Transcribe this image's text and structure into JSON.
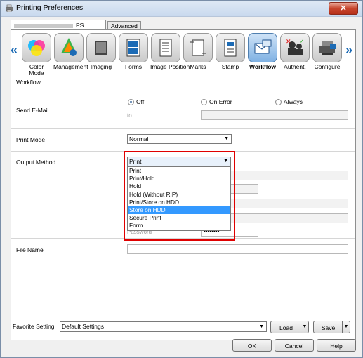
{
  "window": {
    "title": "Printing Preferences",
    "close_glyph": "✕"
  },
  "tabs": [
    {
      "label": "PS"
    },
    {
      "label": "Advanced"
    }
  ],
  "ribbon": {
    "left_arrow": "«",
    "right_arrow": "»",
    "tools": [
      {
        "label": "Color\nMode",
        "icon": "color-mode-icon"
      },
      {
        "label": "Management",
        "icon": "management-icon"
      },
      {
        "label": "Imaging",
        "icon": "imaging-icon"
      },
      {
        "label": "Forms",
        "icon": "forms-icon"
      },
      {
        "label": "Image Position",
        "icon": "image-position-icon"
      },
      {
        "label": "Marks",
        "icon": "marks-icon"
      },
      {
        "label": "Stamp",
        "icon": "stamp-icon"
      },
      {
        "label": "Workflow",
        "icon": "workflow-icon",
        "selected": true
      },
      {
        "label": "Authent.",
        "icon": "authentication-icon"
      },
      {
        "label": "Configure",
        "icon": "configure-icon"
      }
    ]
  },
  "workflow": {
    "section": "Workflow",
    "send_email": {
      "label": "Send E-Mail",
      "options": [
        "Off",
        "On Error",
        "Always"
      ],
      "selected": "Off",
      "to_label": "to"
    },
    "print_mode": {
      "label": "Print Mode",
      "value": "Normal"
    },
    "output_method": {
      "label": "Output Method",
      "value": "Print",
      "options": [
        "Print",
        "Print/Hold",
        "Hold",
        "Hold (Without RIP)",
        "Print/Store on HDD",
        "Store on HDD",
        "Secure Print",
        "Form"
      ],
      "highlighted": "Store on HDD",
      "password_label": "Password",
      "password_mask": "••••••••"
    },
    "file_name": {
      "label": "File Name",
      "value": ""
    }
  },
  "footer": {
    "favorite_label": "Favorite Setting",
    "favorite_value": "Default Settings",
    "load": "Load",
    "save": "Save",
    "ok": "OK",
    "cancel": "Cancel",
    "help": "Help"
  }
}
